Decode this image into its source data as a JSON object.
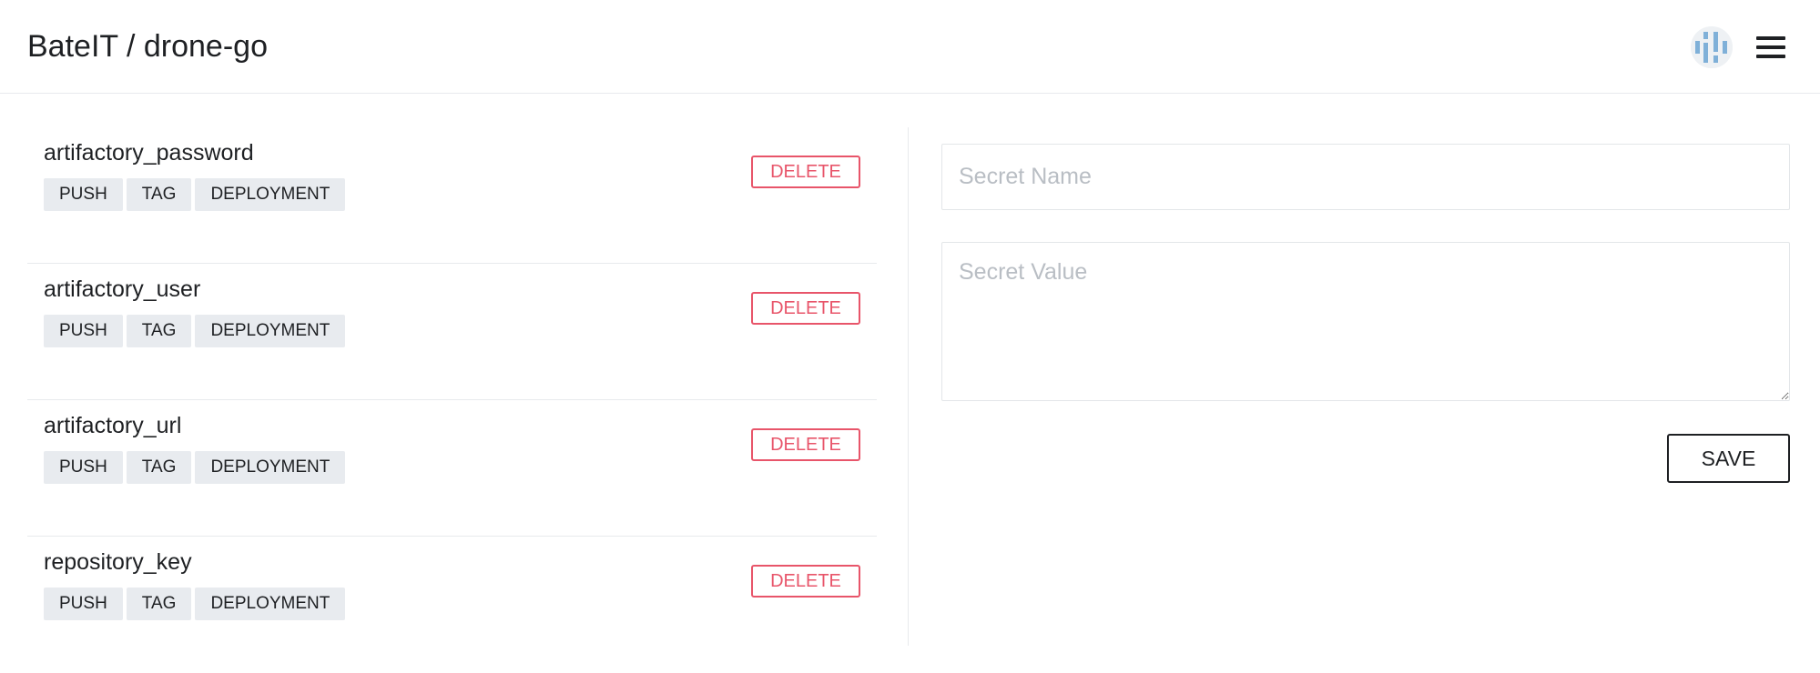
{
  "header": {
    "breadcrumb": "BateIT / drone-go",
    "avatar_icon": "user-avatar-icon",
    "menu_icon": "hamburger-menu-icon"
  },
  "secrets": [
    {
      "name": "artifactory_password",
      "events": [
        "PUSH",
        "TAG",
        "DEPLOYMENT"
      ],
      "delete_label": "DELETE"
    },
    {
      "name": "artifactory_user",
      "events": [
        "PUSH",
        "TAG",
        "DEPLOYMENT"
      ],
      "delete_label": "DELETE"
    },
    {
      "name": "artifactory_url",
      "events": [
        "PUSH",
        "TAG",
        "DEPLOYMENT"
      ],
      "delete_label": "DELETE"
    },
    {
      "name": "repository_key",
      "events": [
        "PUSH",
        "TAG",
        "DEPLOYMENT"
      ],
      "delete_label": "DELETE"
    }
  ],
  "form": {
    "name_placeholder": "Secret Name",
    "name_value": "",
    "value_placeholder": "Secret Value",
    "value_value": "",
    "save_label": "SAVE"
  },
  "colors": {
    "text": "#1e2023",
    "danger": "#e8556a",
    "tag_bg": "#e8ebef",
    "border": "#e8eaed",
    "placeholder": "#b9bec4",
    "avatar_accent": "#7fb0d8"
  }
}
